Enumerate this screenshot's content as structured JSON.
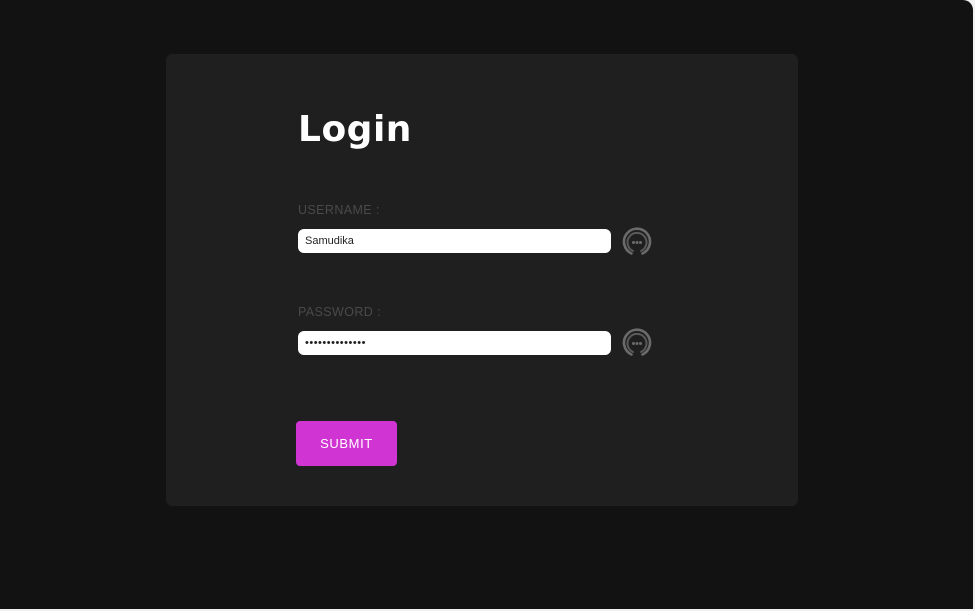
{
  "login": {
    "title": "Login",
    "username": {
      "label": "USERNAME :",
      "value": "Samudika",
      "assist_icon": "password-manager-icon"
    },
    "password": {
      "label": "PASSWORD :",
      "value": "••••••••••••••",
      "assist_icon": "password-manager-icon"
    },
    "submit_label": "SUBMIT"
  },
  "colors": {
    "page_background": "#121212",
    "card_background": "#1f1f1f",
    "label_text": "#4a4a4a",
    "submit_accent": "#d034d3",
    "icon_gray": "#6b6b6b"
  }
}
